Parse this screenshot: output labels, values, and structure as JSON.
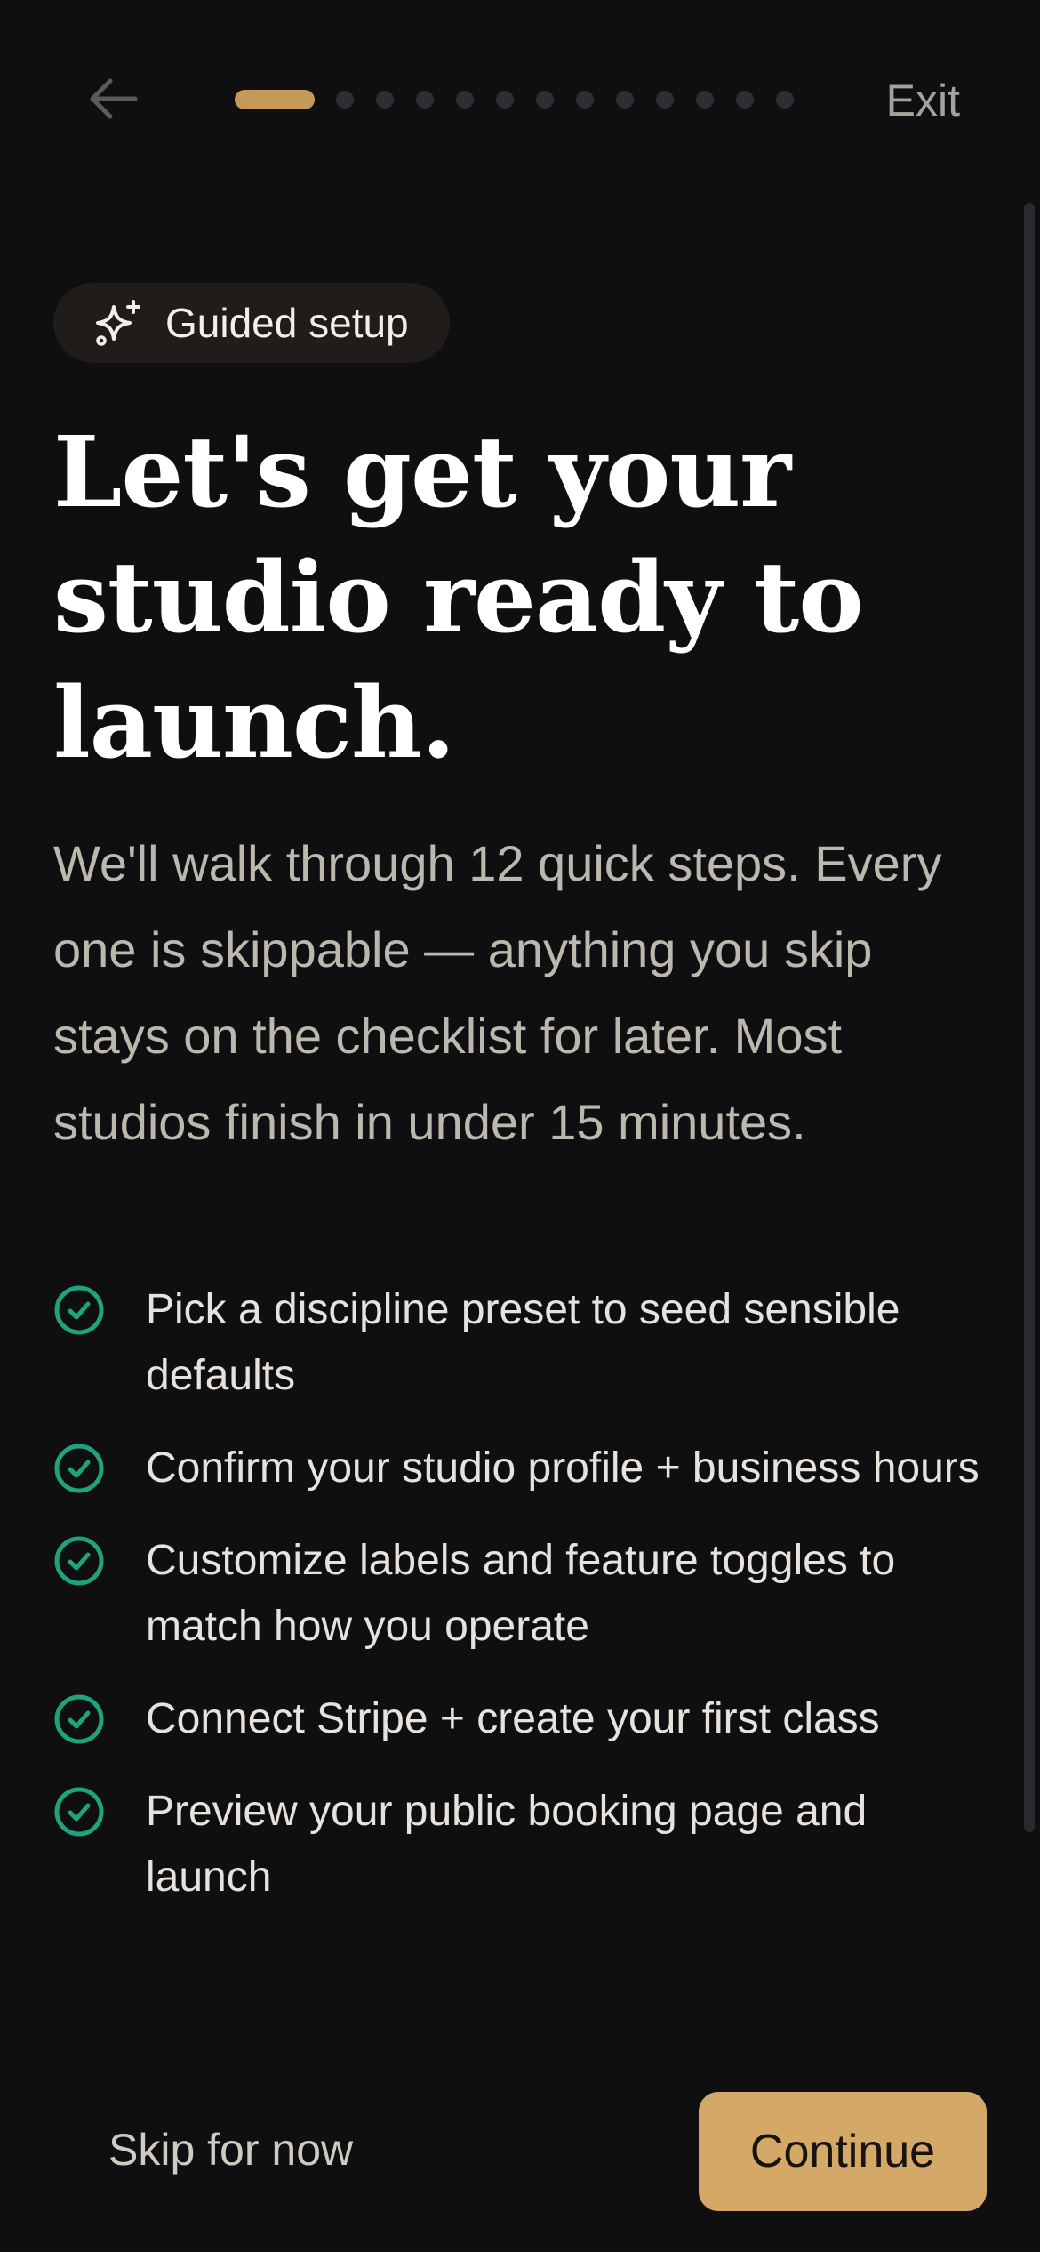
{
  "header": {
    "back_icon": "arrow-left-icon",
    "exit_label": "Exit",
    "progress": {
      "total_steps": 13,
      "current_step": 1
    }
  },
  "badge": {
    "icon": "sparkles-icon",
    "label": "Guided setup"
  },
  "headline": "Let's get your studio ready to launch.",
  "intro": "We'll walk through 12 quick steps. Every one is skippable — anything you skip stays on the checklist for later. Most studios finish in under 15 minutes.",
  "steps": [
    {
      "icon": "check-circle-icon",
      "text": "Pick a discipline preset to seed sensible defaults"
    },
    {
      "icon": "check-circle-icon",
      "text": "Confirm your studio profile + business hours"
    },
    {
      "icon": "check-circle-icon",
      "text": "Customize labels and feature toggles to match how you operate"
    },
    {
      "icon": "check-circle-icon",
      "text": "Connect Stripe + create your first class"
    },
    {
      "icon": "check-circle-icon",
      "text": "Preview your public booking page and launch"
    }
  ],
  "footer": {
    "skip_label": "Skip for now",
    "continue_label": "Continue"
  },
  "colors": {
    "background": "#0f0f11",
    "accent": "#d4a867",
    "progress_active": "#c59a58",
    "check": "#1fa37a"
  }
}
